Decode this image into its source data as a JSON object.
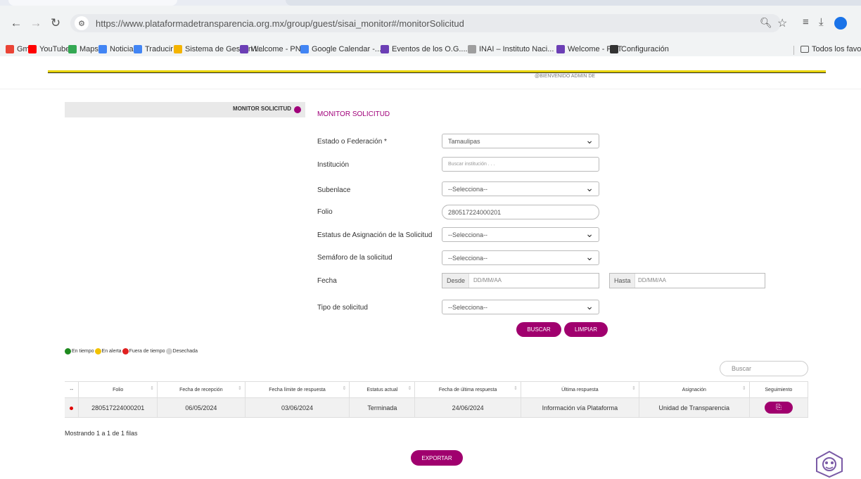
{
  "browser": {
    "url": "https://www.plataformadetransparencia.org.mx/group/guest/sisai_monitor#/monitorSolicitud",
    "bookmarks": [
      {
        "label": "Gmail",
        "color": "#ea4335"
      },
      {
        "label": "YouTube",
        "color": "#ff0000"
      },
      {
        "label": "Maps",
        "color": "#34a853"
      },
      {
        "label": "Noticias",
        "color": "#4285f4"
      },
      {
        "label": "Traducir",
        "color": "#4285f4"
      },
      {
        "label": "Sistema de Gestion I...",
        "color": "#f4b400"
      },
      {
        "label": "Welcome - PNT",
        "color": "#6c3fb5"
      },
      {
        "label": "Google Calendar -...",
        "color": "#4285f4"
      },
      {
        "label": "Eventos de los O.G....",
        "color": "#6c3fb5"
      },
      {
        "label": "INAI – Instituto Naci...",
        "color": "#9e9e9e"
      },
      {
        "label": "Welcome - PNT",
        "color": "#6c3fb5"
      },
      {
        "label": "Configuración",
        "color": "#333333"
      }
    ],
    "all_bookmarks": "Todos los favor"
  },
  "header": {
    "user_line": "@BIENVENIDO ADMIN DE"
  },
  "sidebar": {
    "label": "MONITOR SOLICITUD"
  },
  "form": {
    "title": "MONITOR SOLICITUD",
    "estado_label": "Estado o Federación *",
    "estado_value": "Tamaulipas",
    "institucion_label": "Institución",
    "institucion_placeholder": "Buscar institución . . .",
    "subenlace_label": "Subenlace",
    "subenlace_value": "--Selecciona--",
    "folio_label": "Folio",
    "folio_value": "280517224000201",
    "estatus_label": "Estatus de Asignación de la Solicitud",
    "estatus_value": "--Selecciona--",
    "semaforo_label": "Semáforo de la solicitud",
    "semaforo_value": "--Selecciona--",
    "fecha_label": "Fecha",
    "desde_label": "Desde",
    "desde_placeholder": "DD/MM/AA",
    "hasta_label": "Hasta",
    "hasta_placeholder": "DD/MM/AA",
    "tipo_label": "Tipo de solicitud",
    "tipo_value": "--Selecciona--",
    "buscar_button": "BUSCAR",
    "limpiar_button": "LIMPIAR"
  },
  "legend": {
    "items": [
      {
        "label": "En tiempo",
        "color": "#1e8a1e"
      },
      {
        "label": "En alerta",
        "color": "#f2c200"
      },
      {
        "label": "Fuera de tiempo",
        "color": "#e02020"
      },
      {
        "label": "Desechada",
        "color": "#d0d0d0"
      }
    ]
  },
  "table": {
    "search_placeholder": "Buscar",
    "columns": [
      "--",
      "Folio",
      "Fecha de recepción",
      "Fecha límite de respuesta",
      "Estatus actual",
      "Fecha de última respuesta",
      "Última respuesta",
      "Asignación",
      "Seguimiento"
    ],
    "row": {
      "folio": "280517224000201",
      "recepcion": "06/05/2024",
      "limite": "03/06/2024",
      "estatus": "Terminada",
      "ultima_fecha": "24/06/2024",
      "ultima_respuesta": "Información vía Plataforma",
      "asignacion": "Unidad de Transparencia",
      "status_color": "#e00000"
    },
    "showing": "Mostrando 1 a 1 de 1 filas"
  },
  "export_button": "EXPORTAR",
  "colors": {
    "accent": "#a0006e",
    "title": "#a0007a",
    "bar": "#e6d200"
  }
}
